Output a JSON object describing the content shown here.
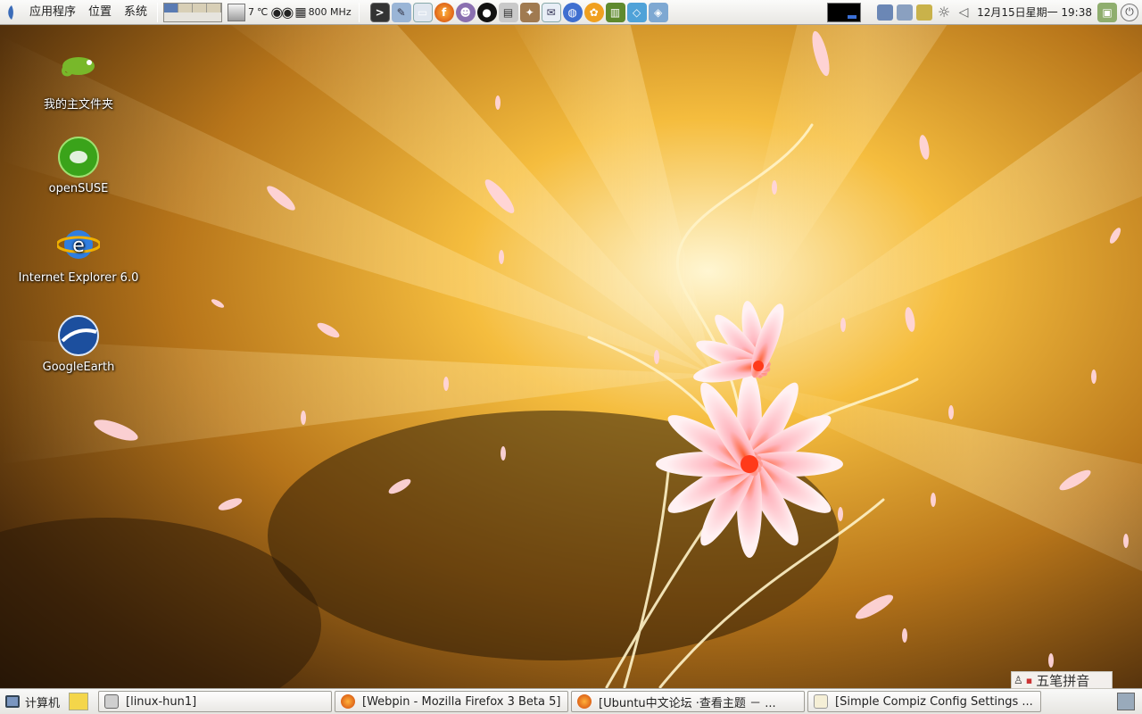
{
  "top_panel": {
    "menus": [
      "应用程序",
      "位置",
      "系统"
    ],
    "temperature": "7",
    "temp_unit": "℃",
    "cpu_freq": "800 MHz",
    "launchers": [
      "terminal-icon",
      "settings-icon",
      "file-manager-icon",
      "firefox-icon",
      "messenger-icon",
      "qq-icon",
      "game-icon",
      "pidgin-icon",
      "mail-icon",
      "network-icon",
      "flower-icon",
      "book-icon",
      "box-icon",
      "cube-icon"
    ],
    "clock": "12月15日星期一  19:38"
  },
  "desktop": {
    "icons": [
      {
        "label": "我的主文件夹"
      },
      {
        "label": "openSUSE"
      },
      {
        "label": "Internet Explorer 6.0"
      },
      {
        "label": "GoogleEarth"
      }
    ]
  },
  "bottom_panel": {
    "show_desktop": "计算机",
    "tasks": [
      {
        "title": "[linux-hun1]"
      },
      {
        "title": "[Webpin - Mozilla Firefox 3 Beta 5]"
      },
      {
        "title": "[Ubuntu中文论坛 ·查看主题 － ..."
      },
      {
        "title": "[Simple Compiz Config Settings ..."
      }
    ]
  },
  "ime": {
    "label": "五笔拼音"
  }
}
